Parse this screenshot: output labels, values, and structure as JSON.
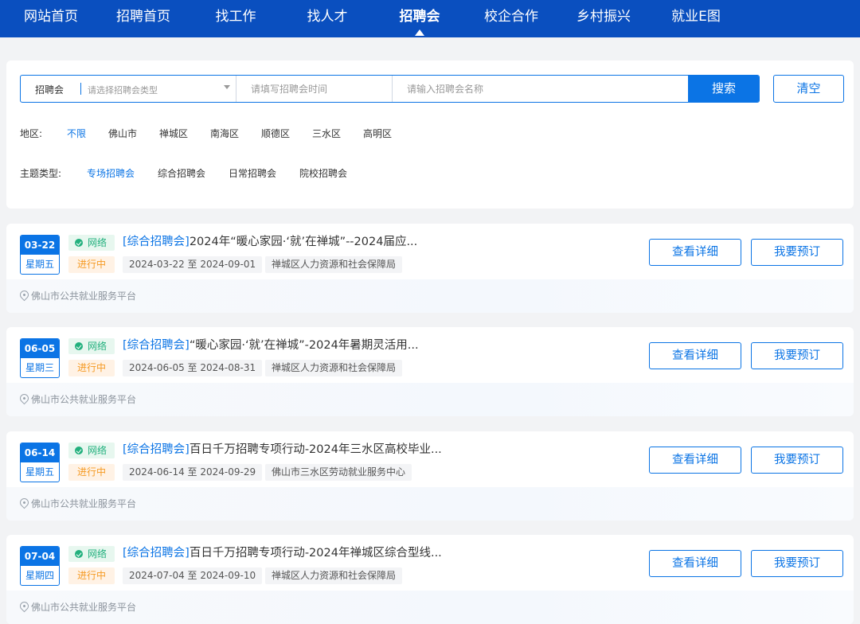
{
  "nav": {
    "items": [
      "网站首页",
      "招聘首页",
      "找工作",
      "找人才",
      "招聘会",
      "校企合作",
      "乡村振兴",
      "就业E图"
    ],
    "active_index": 4
  },
  "search": {
    "type_label": "招聘会",
    "type_placeholder": "请选择招聘会类型",
    "time_placeholder": "请填写招聘会时间",
    "name_placeholder": "请输入招聘会名称",
    "search_button": "搜索",
    "clear_button": "清空"
  },
  "filters": {
    "region_label": "地区:",
    "regions": [
      "不限",
      "佛山市",
      "禅城区",
      "南海区",
      "顺德区",
      "三水区",
      "高明区"
    ],
    "region_active": 0,
    "theme_label": "主题类型:",
    "themes": [
      "专场招聘会",
      "综合招聘会",
      "日常招聘会",
      "院校招聘会"
    ],
    "theme_active": 0
  },
  "cards": [
    {
      "date": "03-22",
      "weekday": "星期五",
      "mode": "网络",
      "status": "进行中",
      "category": "[综合招聘会]",
      "title": "2024年“暖心家园·‘就’在禅城”--2024届应...",
      "range": "2024-03-22 至 2024-09-01",
      "org": "禅城区人力资源和社会保障局",
      "location": "佛山市公共就业服务平台",
      "detail_button": "查看详细",
      "book_button": "我要预订"
    },
    {
      "date": "06-05",
      "weekday": "星期三",
      "mode": "网络",
      "status": "进行中",
      "category": "[综合招聘会]",
      "title": "“暖心家园·‘就’在禅城”-2024年暑期灵活用...",
      "range": "2024-06-05 至 2024-08-31",
      "org": "禅城区人力资源和社会保障局",
      "location": "佛山市公共就业服务平台",
      "detail_button": "查看详细",
      "book_button": "我要预订"
    },
    {
      "date": "06-14",
      "weekday": "星期五",
      "mode": "网络",
      "status": "进行中",
      "category": "[综合招聘会]",
      "title": "百日千万招聘专项行动-2024年三水区高校毕业...",
      "range": "2024-06-14 至 2024-09-29",
      "org": "佛山市三水区劳动就业服务中心",
      "location": "佛山市公共就业服务平台",
      "detail_button": "查看详细",
      "book_button": "我要预订"
    },
    {
      "date": "07-04",
      "weekday": "星期四",
      "mode": "网络",
      "status": "进行中",
      "category": "[综合招聘会]",
      "title": "百日千万招聘专项行动-2024年禅城区综合型线...",
      "range": "2024-07-04 至 2024-09-10",
      "org": "禅城区人力资源和社会保障局",
      "location": "佛山市公共就业服务平台",
      "detail_button": "查看详细",
      "book_button": "我要预订"
    }
  ],
  "colors": {
    "nav_bg": "#0a4fbf",
    "accent": "#0b74e5",
    "online_green": "#22b07d",
    "status_orange": "#f59a23"
  }
}
